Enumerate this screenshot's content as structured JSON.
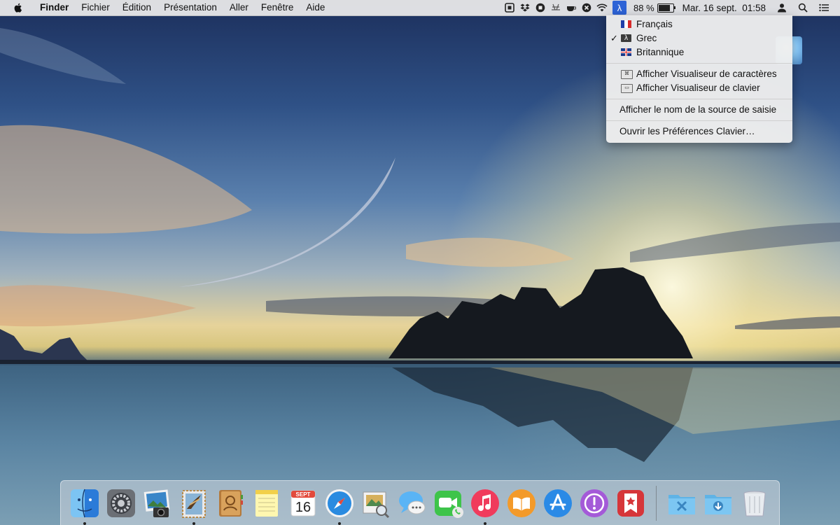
{
  "menubar": {
    "app_name": "Finder",
    "menus": [
      "Fichier",
      "Édition",
      "Présentation",
      "Aller",
      "Fenêtre",
      "Aide"
    ],
    "input_source_symbol": "λ",
    "battery_percent": "88 %",
    "battery_level": 0.88,
    "clock": "Mar. 16 sept.  01:58",
    "status_icons": [
      "screen-icon",
      "dropbox-icon",
      "stop-icon",
      "adobe-icon",
      "coffee-icon",
      "circle-x-icon",
      "wifi-icon"
    ]
  },
  "input_menu": {
    "languages": [
      {
        "label": "Français",
        "checked": false,
        "flag": "france-flag-icon"
      },
      {
        "label": "Grec",
        "checked": true,
        "flag": "greek-input-icon"
      },
      {
        "label": "Britannique",
        "checked": false,
        "flag": "uk-flag-icon"
      }
    ],
    "check_mark": "✓",
    "viewers": [
      "Afficher Visualiseur de caractères",
      "Afficher Visualiseur de clavier"
    ],
    "show_name": "Afficher le nom de la source de saisie",
    "open_prefs": "Ouvrir les Préférences Clavier…"
  },
  "dock": {
    "calendar_month": "SEPT",
    "calendar_day": "16",
    "apps": [
      "finder-icon",
      "system-preferences-icon",
      "iphoto-icon",
      "mail-icon",
      "contacts-icon",
      "notes-icon",
      "calendar-icon",
      "safari-icon",
      "preview-icon",
      "messages-icon",
      "facetime-icon",
      "itunes-icon",
      "ibooks-icon",
      "app-store-icon",
      "podcasts-icon",
      "wunderlist-icon"
    ],
    "running": [
      "finder-icon",
      "mail-icon",
      "safari-icon",
      "itunes-icon"
    ]
  },
  "colors": {
    "menu_highlight": "#2d63d6",
    "menubar_bg": "#ececec"
  }
}
